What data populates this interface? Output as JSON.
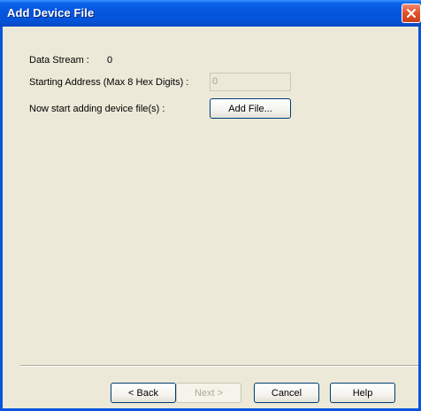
{
  "window": {
    "title": "Add Device File",
    "close_icon": "close-icon"
  },
  "form": {
    "data_stream_label": "Data Stream :",
    "data_stream_value": "0",
    "starting_address_label": "Starting Address (Max 8 Hex Digits) :",
    "starting_address_value": "0",
    "add_files_label": "Now start adding device file(s) :",
    "add_file_button": "Add File..."
  },
  "footer": {
    "back_button": "< Back",
    "next_button": "Next >",
    "cancel_button": "Cancel",
    "help_button": "Help"
  },
  "colors": {
    "titlebar": "#0655de",
    "window_bg": "#ece9d8",
    "close_button": "#e0502a"
  }
}
